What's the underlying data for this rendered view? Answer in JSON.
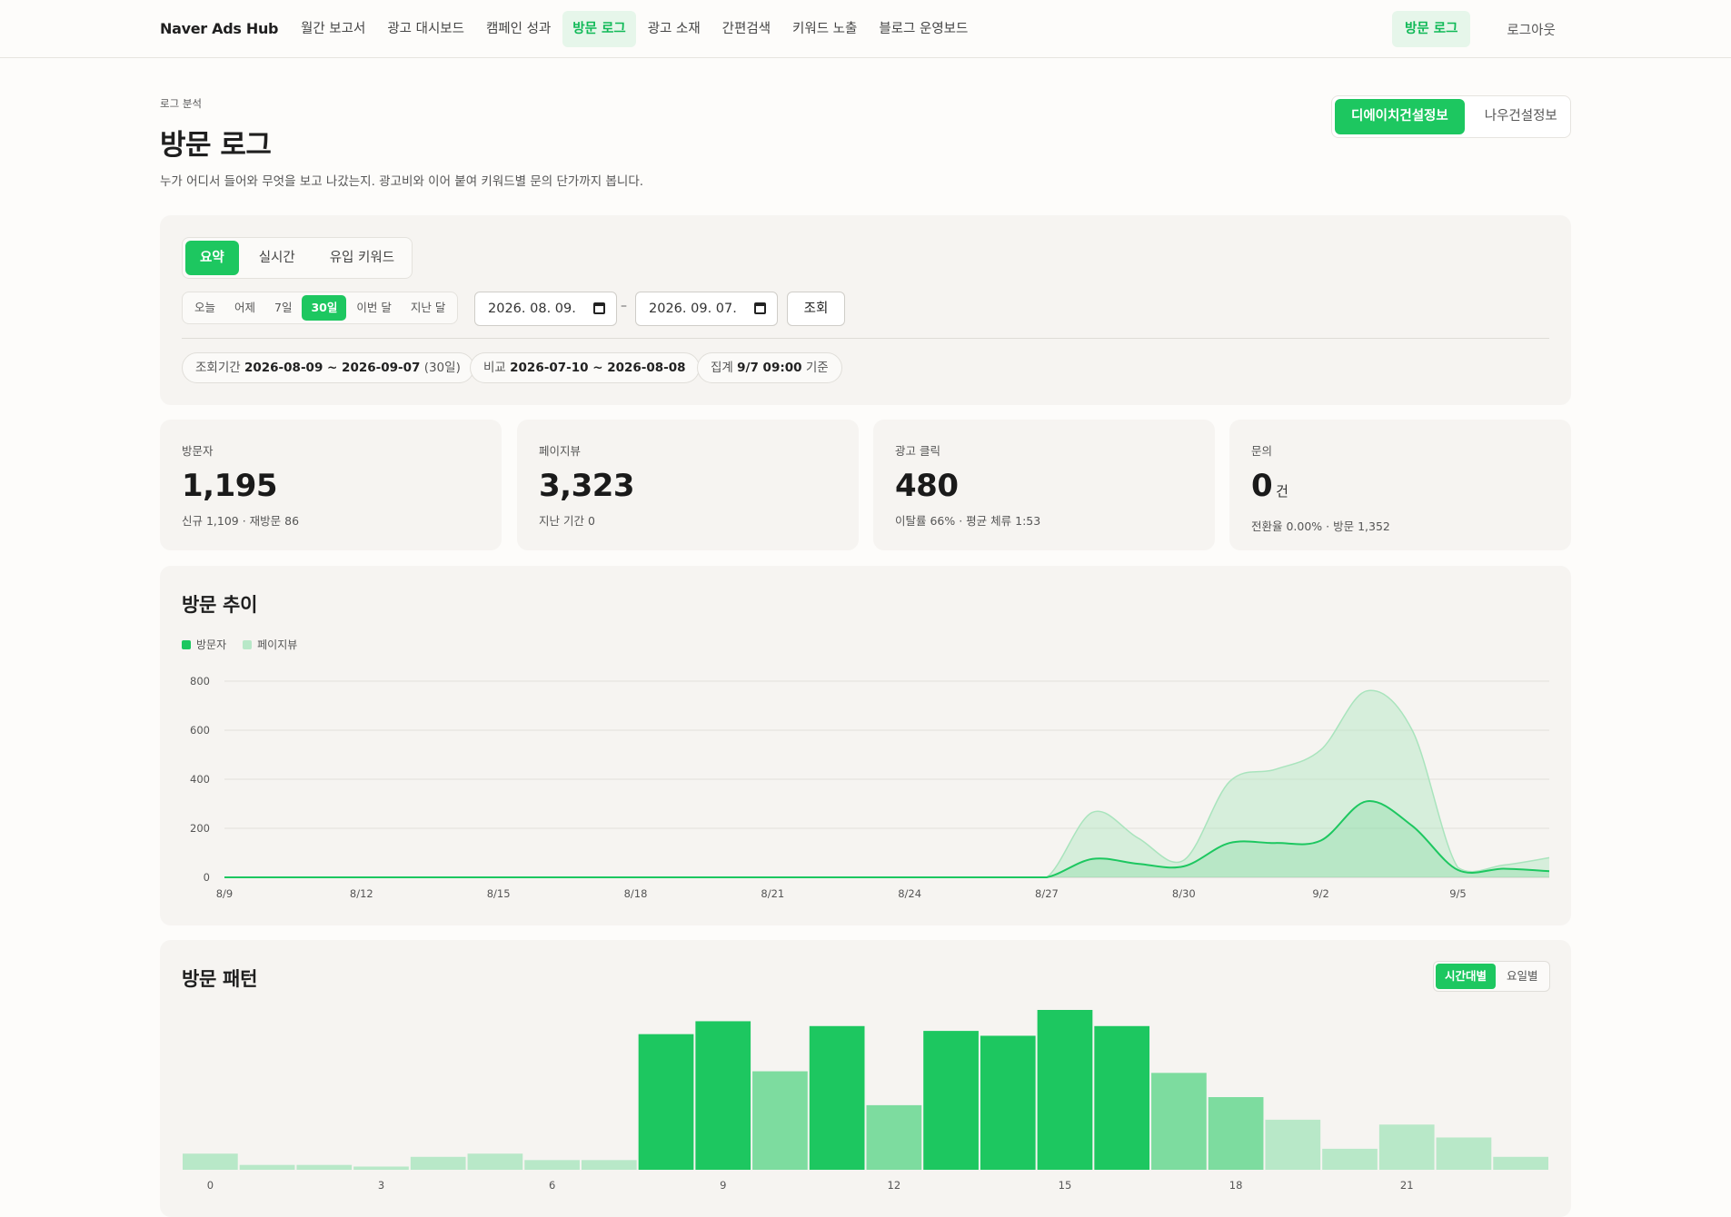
{
  "nav": {
    "brand": "Naver Ads Hub",
    "items": [
      "월간 보고서",
      "광고 대시보드",
      "캠페인 성과",
      "방문 로그",
      "광고 소재",
      "간편검색",
      "키워드 노출",
      "블로그 운영보드"
    ],
    "active_index": 3,
    "cta": "방문 로그",
    "logout": "로그아웃"
  },
  "header": {
    "eyebrow": "로그 분석",
    "title": "방문 로그",
    "subtitle": "누가 어디서 들어와 무엇을 보고 나갔는지. 광고비와 이어 붙여 키워드별 문의 단가까지 봅니다."
  },
  "accounts": {
    "items": [
      "디에이치건설정보",
      "나우건설정보"
    ],
    "active_index": 0
  },
  "filters": {
    "views": [
      "요약",
      "실시간",
      "유입 키워드"
    ],
    "view_active": 0,
    "ranges": [
      "오늘",
      "어제",
      "7일",
      "30일",
      "이번 달",
      "지난 달"
    ],
    "range_active": 3,
    "date_from": "2026. 08. 09.",
    "date_to": "2026. 09. 07.",
    "date_sep": "–",
    "query": "조회",
    "pills": {
      "period_label": "조회기간",
      "period_value": "2026-08-09 ~ 2026-09-07",
      "period_days": "(30일)",
      "compare_label": "비교",
      "compare_value": "2026-07-10 ~ 2026-08-08",
      "agg_label": "집계",
      "agg_value": "9/7 09:00",
      "agg_suffix": "기준"
    }
  },
  "kpis": [
    {
      "label": "방문자",
      "value": "1,195",
      "unit": "",
      "sub": "신규 1,109 · 재방문 86"
    },
    {
      "label": "페이지뷰",
      "value": "3,323",
      "unit": "",
      "sub": "지난 기간 0"
    },
    {
      "label": "광고 클릭",
      "value": "480",
      "unit": "",
      "sub": "이탈률 66% · 평균 체류 1:53"
    },
    {
      "label": "문의",
      "value": "0",
      "unit": "건",
      "sub": "전환율 0.00% · 방문 1,352"
    }
  ],
  "trend": {
    "title": "방문 추이",
    "legend": [
      "방문자",
      "페이지뷰"
    ],
    "colors": {
      "visitors": "#1dc760",
      "pageviews": "#a9e4bd"
    }
  },
  "pattern": {
    "title": "방문 패턴",
    "toggle": [
      "시간대별",
      "요일별"
    ],
    "toggle_active": 0
  },
  "chart_data": [
    {
      "type": "area",
      "title": "방문 추이",
      "x": [
        "8/9",
        "8/10",
        "8/11",
        "8/12",
        "8/13",
        "8/14",
        "8/15",
        "8/16",
        "8/17",
        "8/18",
        "8/19",
        "8/20",
        "8/21",
        "8/22",
        "8/23",
        "8/24",
        "8/25",
        "8/26",
        "8/27",
        "8/28",
        "8/29",
        "8/30",
        "8/31",
        "9/1",
        "9/2",
        "9/3",
        "9/4",
        "9/5",
        "9/6",
        "9/7"
      ],
      "x_tick_labels": [
        "8/9",
        "8/12",
        "8/15",
        "8/18",
        "8/21",
        "8/24",
        "8/27",
        "8/30",
        "9/2",
        "9/5"
      ],
      "ylim": [
        0,
        800
      ],
      "y_ticks": [
        0,
        200,
        400,
        600,
        800
      ],
      "grid": true,
      "legend_position": "top-left",
      "series": [
        {
          "name": "방문자",
          "values": [
            0,
            0,
            0,
            0,
            0,
            0,
            0,
            0,
            0,
            0,
            0,
            0,
            0,
            0,
            0,
            0,
            0,
            0,
            0,
            75,
            55,
            45,
            140,
            140,
            150,
            310,
            210,
            30,
            35,
            25
          ]
        },
        {
          "name": "페이지뷰",
          "values": [
            0,
            0,
            0,
            0,
            0,
            0,
            0,
            0,
            0,
            0,
            0,
            0,
            0,
            0,
            0,
            0,
            0,
            0,
            0,
            265,
            160,
            70,
            390,
            440,
            520,
            760,
            600,
            40,
            50,
            80
          ]
        }
      ]
    },
    {
      "type": "bar",
      "title": "방문 패턴",
      "categories": [
        "0",
        "1",
        "2",
        "3",
        "4",
        "5",
        "6",
        "7",
        "8",
        "9",
        "10",
        "11",
        "12",
        "13",
        "14",
        "15",
        "16",
        "17",
        "18",
        "19",
        "20",
        "21",
        "22",
        "23"
      ],
      "x_tick_labels": [
        "0",
        "3",
        "6",
        "9",
        "12",
        "15",
        "18",
        "21"
      ],
      "values": [
        10,
        3,
        3,
        2,
        8,
        10,
        6,
        6,
        84,
        92,
        61,
        89,
        40,
        86,
        83,
        99,
        89,
        60,
        45,
        31,
        13,
        28,
        20,
        8
      ],
      "colors": {
        "high": "#1dc760",
        "mid": "#7ddc9f",
        "low": "#b8e8c8"
      }
    }
  ]
}
